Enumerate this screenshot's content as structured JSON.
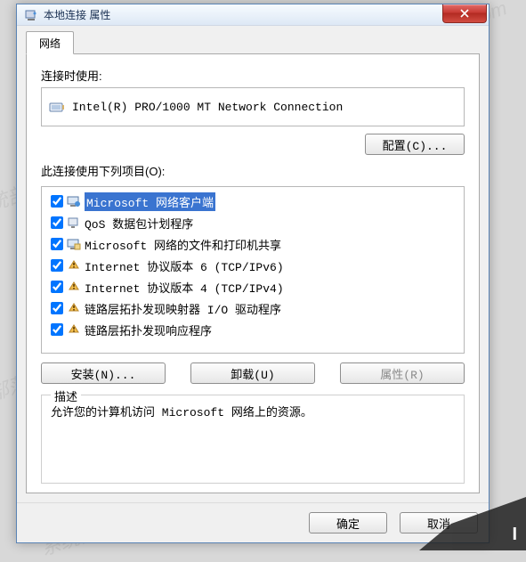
{
  "window": {
    "title": "本地连接 属性"
  },
  "tab": {
    "label": "网络"
  },
  "connect": {
    "label": "连接时使用:",
    "adapter": "Intel(R) PRO/1000 MT Network Connection",
    "configure": "配置(C)..."
  },
  "items": {
    "label": "此连接使用下列项目(O):",
    "list": [
      {
        "checked": true,
        "icon": "client",
        "label": "Microsoft 网络客户端",
        "selected": true
      },
      {
        "checked": true,
        "icon": "sched",
        "label": "QoS 数据包计划程序"
      },
      {
        "checked": true,
        "icon": "share",
        "label": "Microsoft 网络的文件和打印机共享"
      },
      {
        "checked": true,
        "icon": "proto",
        "label": "Internet 协议版本 6 (TCP/IPv6)"
      },
      {
        "checked": true,
        "icon": "proto",
        "label": "Internet 协议版本 4 (TCP/IPv4)"
      },
      {
        "checked": true,
        "icon": "proto",
        "label": "链路层拓扑发现映射器 I/O 驱动程序"
      },
      {
        "checked": true,
        "icon": "proto",
        "label": "链路层拓扑发现响应程序"
      }
    ],
    "install": "安装(N)...",
    "uninstall": "卸载(U)",
    "properties": "属性(R)"
  },
  "description": {
    "legend": "描述",
    "text": "允许您的计算机访问 Microsoft 网络上的资源。"
  },
  "dialog": {
    "ok": "确定",
    "cancel": "取消"
  }
}
